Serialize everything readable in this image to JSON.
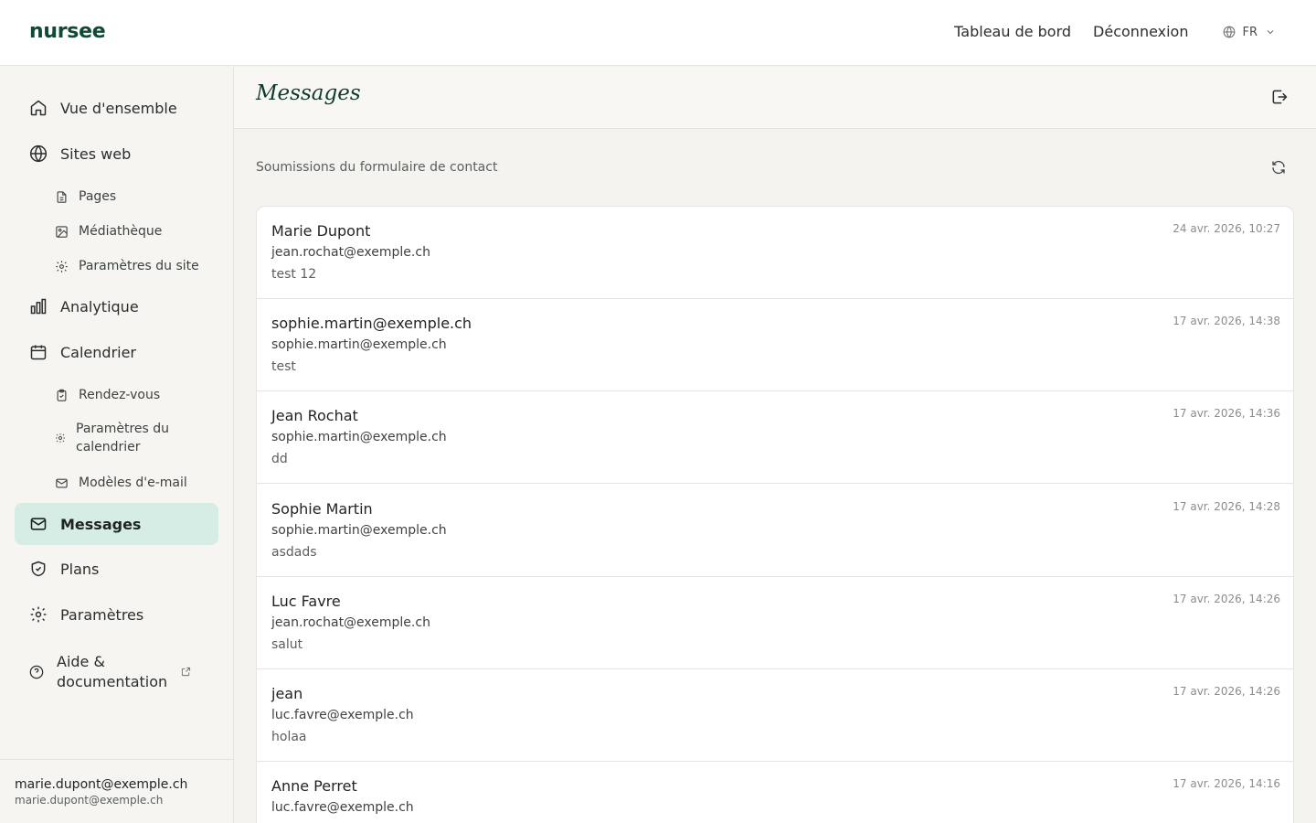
{
  "topbar": {
    "brand": "nursee",
    "nav": [
      "Tableau de bord",
      "Déconnexion"
    ],
    "lang": "FR"
  },
  "sidebar": {
    "items": [
      {
        "label": "Vue d'ensemble",
        "icon": "home-icon"
      },
      {
        "label": "Sites web",
        "icon": "globe-icon"
      },
      {
        "label": "Analytique",
        "icon": "bar-chart-icon"
      },
      {
        "label": "Calendrier",
        "icon": "calendar-icon"
      },
      {
        "label": "Messages",
        "icon": "mail-icon",
        "active": true
      },
      {
        "label": "Plans",
        "icon": "shield-check-icon"
      },
      {
        "label": "Paramètres",
        "icon": "gear-icon"
      },
      {
        "label": "Aide & documentation",
        "icon": "help-circle-icon"
      }
    ],
    "sites_sub": [
      {
        "label": "Pages",
        "icon": "file-icon"
      },
      {
        "label": "Médiathèque",
        "icon": "image-icon"
      },
      {
        "label": "Paramètres du site",
        "icon": "gear-icon"
      }
    ],
    "calendar_sub": [
      {
        "label": "Rendez-vous",
        "icon": "clipboard-check-icon"
      },
      {
        "label": "Paramètres du calendrier",
        "icon": "gear-icon"
      },
      {
        "label": "Modèles d'e-mail",
        "icon": "mail-icon"
      }
    ],
    "footer": {
      "name": "marie.dupont@exemple.ch",
      "email": "marie.dupont@exemple.ch"
    }
  },
  "main": {
    "title": "Messages",
    "section_label": "Soumissions du formulaire de contact",
    "messages": [
      {
        "name": "Marie Dupont",
        "email": "jean.rochat@exemple.ch",
        "text": "test 12",
        "date": "24 avr. 2026, 10:27"
      },
      {
        "name": "sophie.martin@exemple.ch",
        "email": "sophie.martin@exemple.ch",
        "text": "test",
        "date": "17 avr. 2026, 14:38"
      },
      {
        "name": "Jean Rochat",
        "email": "sophie.martin@exemple.ch",
        "text": "dd",
        "date": "17 avr. 2026, 14:36"
      },
      {
        "name": "Sophie Martin",
        "email": "sophie.martin@exemple.ch",
        "text": "asdads",
        "date": "17 avr. 2026, 14:28"
      },
      {
        "name": "Luc Favre",
        "email": "jean.rochat@exemple.ch",
        "text": "salut",
        "date": "17 avr. 2026, 14:26"
      },
      {
        "name": "jean",
        "email": "luc.favre@exemple.ch",
        "text": "holaa",
        "date": "17 avr. 2026, 14:26"
      },
      {
        "name": "Anne Perret",
        "email": "luc.favre@exemple.ch",
        "text": "",
        "date": "17 avr. 2026, 14:16"
      }
    ]
  },
  "colors": {
    "brand": "#0f4a38",
    "active_bg": "#d6ede5",
    "sidebar_bg": "#f6f5f1",
    "content_bg": "#f4f3ef"
  }
}
